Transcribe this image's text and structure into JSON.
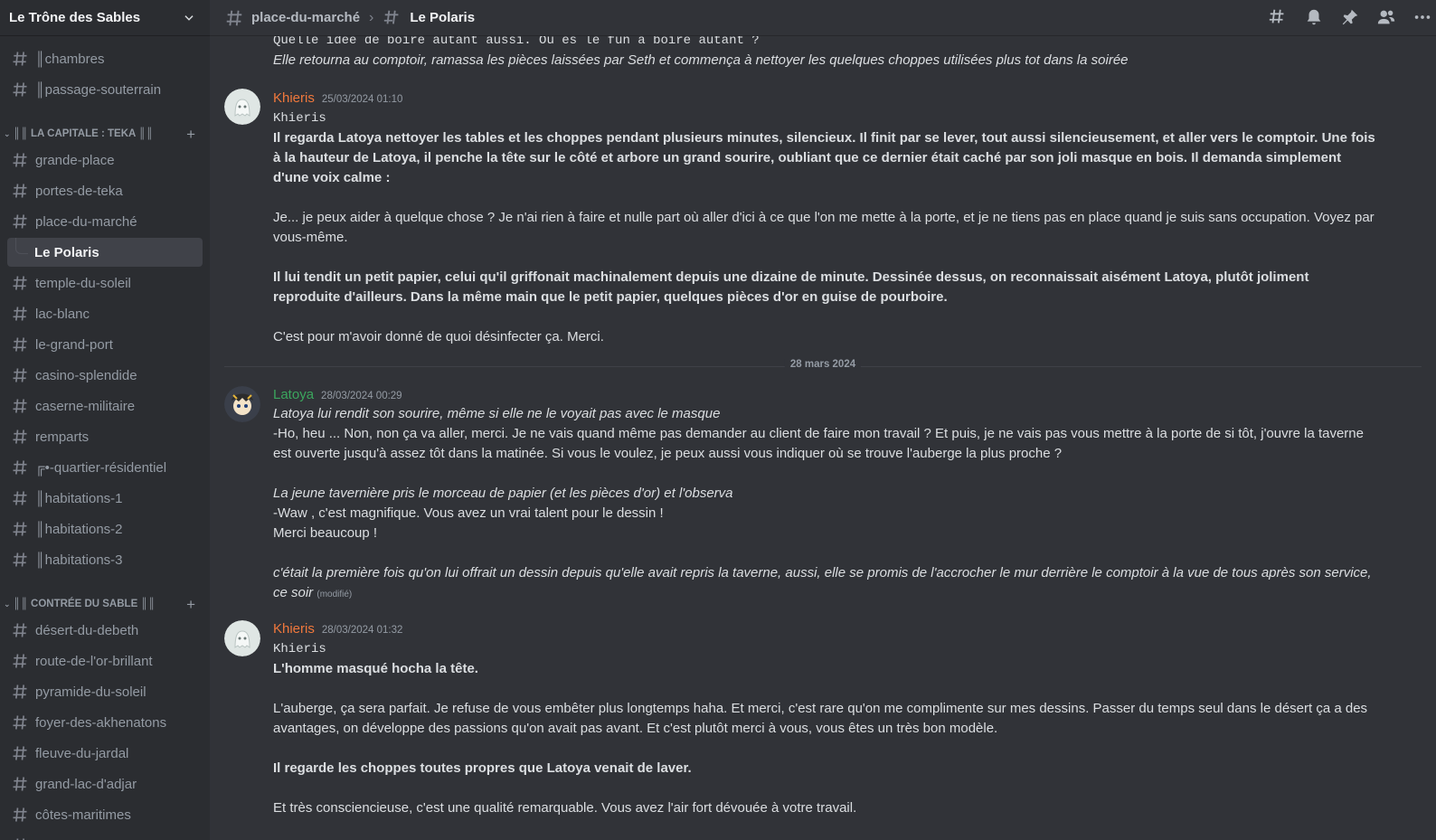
{
  "server": {
    "name": "Le Trône des Sables"
  },
  "sidebar": {
    "top_channels": [
      {
        "name": "║chambres"
      },
      {
        "name": "║passage-souterrain"
      }
    ],
    "category1": {
      "label": "║║ LA CAPITALE : TEKA ║║",
      "add": "+"
    },
    "capitale_channels": [
      {
        "name": "grande-place"
      },
      {
        "name": "portes-de-teka"
      },
      {
        "name": "place-du-marché"
      }
    ],
    "active_thread": {
      "name": "Le Polaris"
    },
    "capitale_channels_2": [
      {
        "name": "temple-du-soleil"
      },
      {
        "name": "lac-blanc"
      },
      {
        "name": "le-grand-port"
      },
      {
        "name": "casino-splendide"
      },
      {
        "name": "caserne-militaire"
      },
      {
        "name": "remparts"
      },
      {
        "name": "╔•-quartier-résidentiel"
      },
      {
        "name": "║habitations-1"
      },
      {
        "name": "║habitations-2"
      },
      {
        "name": "║habitations-3"
      }
    ],
    "category2": {
      "label": "║║ CONTRÉE DU SABLE ║║",
      "add": "+"
    },
    "sable_channels": [
      {
        "name": "désert-du-debeth"
      },
      {
        "name": "route-de-l'or-brillant"
      },
      {
        "name": "pyramide-du-soleil"
      },
      {
        "name": "foyer-des-akhenatons"
      },
      {
        "name": "fleuve-du-jardal"
      },
      {
        "name": "grand-lac-d'adjar"
      },
      {
        "name": "côtes-maritimes"
      },
      {
        "name": "anciennes-ruines"
      }
    ]
  },
  "topbar": {
    "channel": "place-du-marché",
    "separator": "›",
    "thread": "Le Polaris"
  },
  "colors": {
    "khieris": "#f0783c",
    "latoya": "#3ba55d",
    "accent": "#5865f2"
  },
  "messages": {
    "m0": {
      "mono": "Quelle idée de boire autant aussi. Où es le fun à boire autant ?",
      "italic": "Elle retourna au comptoir, ramassa les pièces laissées par Seth et commença à nettoyer les quelques choppes utilisées plus tot dans la soirée"
    },
    "m1": {
      "author": "Khieris",
      "timestamp": "25/03/2024 01:10",
      "mono": "Khieris",
      "p1": "Il regarda Latoya nettoyer les tables et les choppes pendant plusieurs minutes, silencieux. Il finit par se lever, tout aussi silencieusement, et aller vers le comptoir. Une fois à la hauteur de Latoya, il penche la tête sur le côté et arbore un grand sourire, oubliant que ce dernier était caché par son joli masque en bois. Il demanda simplement d'une voix calme :",
      "p2": "Je... je peux aider à quelque chose ? Je n'ai rien à faire et nulle part où aller d'ici à ce que l'on me mette à la porte, et je ne tiens pas en place quand je suis sans occupation. Voyez par vous-même.",
      "p3": "Il lui tendit un petit papier, celui qu'il griffonait machinalement depuis une dizaine de minute. Dessinée dessus, on reconnaissait aisément Latoya, plutôt joliment reproduite d'ailleurs. Dans la même main que le petit papier, quelques pièces d'or en guise de pourboire.",
      "p4": "C'est pour m'avoir donné de quoi désinfecter ça. Merci."
    },
    "date_divider": "28 mars 2024",
    "m2": {
      "author": "Latoya",
      "timestamp": "28/03/2024 00:29",
      "l1": "Latoya lui rendit son sourire, même si elle ne le voyait pas avec le masque",
      "l2": "-Ho, heu ... Non, non ça va aller, merci. Je ne vais quand même pas demander au client de faire mon travail ? Et puis, je ne vais pas vous mettre à la porte de si tôt, j'ouvre la taverne est ouverte jusqu'à assez tôt dans la matinée.  Si vous le voulez, je peux aussi vous indiquer où se trouve l'auberge la plus proche ?",
      "l3": "La jeune tavernière pris le morceau de papier (et les pièces d'or) et l'observa",
      "l4": "-Waw , c'est magnifique. Vous avez un vrai talent pour le dessin !",
      "l5": "Merci beaucoup !",
      "l6": "c'était la première fois qu'on lui offrait un dessin depuis qu'elle avait repris la taverne, aussi, elle se promis de l'accrocher le mur derrière le comptoir à la vue de tous après son service, ce soir",
      "edited": "(modifié)"
    },
    "m3": {
      "author": "Khieris",
      "timestamp": "28/03/2024 01:32",
      "mono": "Khieris",
      "p1": "L'homme masqué hocha la tête.",
      "p2": "L'auberge, ça sera parfait. Je refuse de vous embêter plus longtemps haha. Et merci, c'est rare qu'on me complimente sur mes dessins. Passer du temps seul dans le désert ça a des avantages, on développe des passions qu'on avait pas avant. Et c'est plutôt merci à vous, vous êtes un très bon modèle.",
      "p3": "Il regarde les choppes toutes propres que Latoya venait de laver.",
      "p4": "Et très consciencieuse, c'est une qualité remarquable. Vous avez l'air fort dévouée à votre travail."
    }
  }
}
